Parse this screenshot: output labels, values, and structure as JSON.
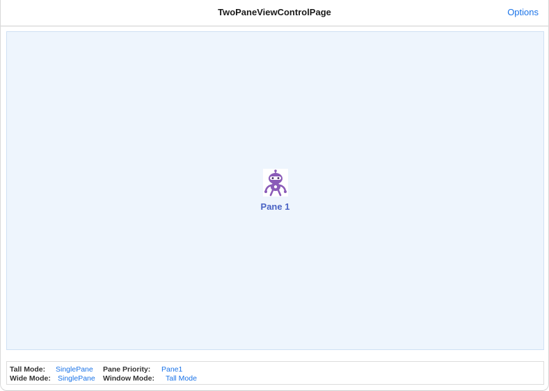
{
  "navbar": {
    "title": "TwoPaneViewControlPage",
    "options_label": "Options"
  },
  "pane": {
    "icon": "robot-mascot-icon",
    "label": "Pane 1"
  },
  "status": {
    "tall_mode_label": "Tall Mode:",
    "tall_mode_value": "SinglePane",
    "pane_priority_label": "Pane Priority:",
    "pane_priority_value": "Pane1",
    "wide_mode_label": "Wide Mode:",
    "wide_mode_value": "SinglePane",
    "window_mode_label": "Window Mode:",
    "window_mode_value": "Tall Mode"
  },
  "colors": {
    "accent": "#1a73e8",
    "pane_background": "#eef5fd",
    "pane_label": "#4a63c4",
    "robot": "#8a5bb8"
  }
}
